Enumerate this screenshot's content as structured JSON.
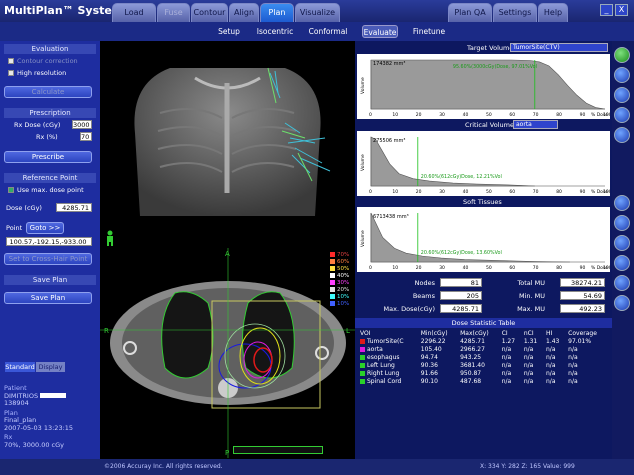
{
  "app": {
    "title": "MultiPlan™ System"
  },
  "tabs": [
    {
      "label": "Load",
      "state": "normal"
    },
    {
      "label": "Fuse",
      "state": "disabled"
    },
    {
      "label": "Contour",
      "state": "normal"
    },
    {
      "label": "Align",
      "state": "normal"
    },
    {
      "label": "Plan",
      "state": "active"
    },
    {
      "label": "Visualize",
      "state": "normal"
    },
    {
      "label": "Plan QA",
      "state": "normal"
    },
    {
      "label": "Settings",
      "state": "normal"
    },
    {
      "label": "Help",
      "state": "normal"
    }
  ],
  "window": {
    "minimize": "_",
    "close": "X"
  },
  "subtabs": [
    {
      "label": "Setup"
    },
    {
      "label": "Isocentric"
    },
    {
      "label": "Conformal"
    },
    {
      "label": "Evaluate",
      "active": true
    },
    {
      "label": "Finetune"
    }
  ],
  "left": {
    "evaluation": {
      "header": "Evaluation",
      "contour_correction": "Contour correction",
      "high_resolution": "High resolution",
      "calculate": "Calculate"
    },
    "prescription": {
      "header": "Prescription",
      "rx_dose_label": "Rx Dose (cGy)",
      "rx_dose_value": "3000",
      "rx_pct_label": "Rx (%)",
      "rx_pct_value": "70",
      "prescribe": "Prescribe"
    },
    "reference": {
      "header": "Reference Point",
      "use_max": "Use max. dose point",
      "dose_label": "Dose (cGy)",
      "dose_value": "4285.71",
      "point_label": "Point",
      "goto": "Goto >>",
      "point_value": "100.57,-192.15,-933.00",
      "set_crosshair": "Set to Cross-Hair Point"
    },
    "save": {
      "header": "Save Plan",
      "save_button": "Save Plan"
    },
    "view_tabs": [
      "Standard",
      "Display"
    ],
    "patient": {
      "label": "Patient",
      "name": "DIMITRIOS",
      "id": "138904",
      "plan_label": "Plan",
      "plan_name": "Final_plan",
      "plan_date": "2007-05-03 13:23:15",
      "rx_label": "Rx",
      "rx_value": "70%, 3000.00 cGy"
    }
  },
  "center": {
    "axial_label_top": "A",
    "axial_label_bottom": "P",
    "axial_label_right": "L",
    "axial_label_left": "R",
    "iso_legend": [
      "70%",
      "60%",
      "50%",
      "40%",
      "30%",
      "20%",
      "10%",
      "10%"
    ]
  },
  "right": {
    "target_volume_label": "Target Volume:",
    "target_volume": "TumorSite(CTV)",
    "target_plot": {
      "vol": "174382 mm³",
      "annotation": "95.60%(3000cGy)Dose, 97.01%Vol"
    },
    "critical_volume_label": "Critical Volume:",
    "critical_volume": "aorta",
    "critical_plot": {
      "vol": "275506 mm³",
      "annotation": "20.60%(612cGy)Dose, 12.21%Vol"
    },
    "soft_label": "Soft Tissues",
    "soft_plot": {
      "vol": "6713438 mm³",
      "annotation": "20.60%(612cGy)Dose, 13.60%Vol"
    },
    "axis": {
      "ylabel": "Volume",
      "xlabel": "% Dose",
      "xticks": [
        "0",
        "10",
        "20",
        "30",
        "40",
        "50",
        "60",
        "70",
        "80",
        "90",
        "100"
      ]
    },
    "stats": {
      "nodes_label": "Nodes",
      "nodes": "81",
      "beams_label": "Beams",
      "beams": "205",
      "maxdose_label": "Max. Dose(cGy)",
      "maxdose": "4285.71",
      "totalmu_label": "Total MU",
      "totalmu": "38274.21",
      "minmu_label": "Min. MU",
      "minmu": "54.69",
      "maxmu_label": "Max. MU",
      "maxmu": "492.23"
    },
    "table_title": "Dose Statistic Table",
    "table_headers": [
      "VOI",
      "Min(cGy)",
      "Max(cGy)",
      "CI",
      "nCI",
      "HI",
      "Coverage"
    ],
    "table_rows": [
      {
        "voi": "TumorSite(C",
        "min": "2296.22",
        "max": "4285.71",
        "ci": "1.27",
        "nci": "1.31",
        "hi": "1.43",
        "cov": "97.01%",
        "color": "#e01a1a"
      },
      {
        "voi": "aorta",
        "min": "105.40",
        "max": "2966.27",
        "ci": "n/a",
        "nci": "n/a",
        "hi": "n/a",
        "cov": "n/a",
        "color": "#e01ae0"
      },
      {
        "voi": "esophagus",
        "min": "94.74",
        "max": "943.25",
        "ci": "n/a",
        "nci": "n/a",
        "hi": "n/a",
        "cov": "n/a",
        "color": "#2ad02a"
      },
      {
        "voi": "Left Lung",
        "min": "90.36",
        "max": "3681.40",
        "ci": "n/a",
        "nci": "n/a",
        "hi": "n/a",
        "cov": "n/a",
        "color": "#2ad02a"
      },
      {
        "voi": "Right Lung",
        "min": "91.66",
        "max": "950.87",
        "ci": "n/a",
        "nci": "n/a",
        "hi": "n/a",
        "cov": "n/a",
        "color": "#2ad02a"
      },
      {
        "voi": "Spinal Cord",
        "min": "90.10",
        "max": "487.68",
        "ci": "n/a",
        "nci": "n/a",
        "hi": "n/a",
        "cov": "n/a",
        "color": "#2ad02a"
      }
    ]
  },
  "chart_data": [
    {
      "type": "line",
      "title": "TumorSite(CTV)",
      "xlabel": "% Dose",
      "ylabel": "Volume",
      "xlim": [
        0,
        100
      ],
      "ylim": [
        0,
        100
      ],
      "series": [
        {
          "values": [
            [
              0,
              100
            ],
            [
              60,
              100
            ],
            [
              68,
              99
            ],
            [
              72,
              96
            ],
            [
              76,
              88
            ],
            [
              80,
              70
            ],
            [
              84,
              48
            ],
            [
              88,
              28
            ],
            [
              92,
              12
            ],
            [
              96,
              3
            ],
            [
              100,
              0
            ]
          ]
        }
      ]
    },
    {
      "type": "line",
      "title": "aorta",
      "xlabel": "% Dose",
      "ylabel": "Volume",
      "xlim": [
        0,
        100
      ],
      "ylim": [
        0,
        100
      ],
      "series": [
        {
          "values": [
            [
              0,
              100
            ],
            [
              2,
              95
            ],
            [
              5,
              70
            ],
            [
              8,
              45
            ],
            [
              12,
              25
            ],
            [
              18,
              15
            ],
            [
              25,
              10
            ],
            [
              35,
              6
            ],
            [
              45,
              4
            ],
            [
              60,
              2
            ],
            [
              70,
              0
            ]
          ]
        }
      ]
    },
    {
      "type": "line",
      "title": "Soft Tissues",
      "xlabel": "% Dose",
      "ylabel": "Volume",
      "xlim": [
        0,
        100
      ],
      "ylim": [
        0,
        100
      ],
      "series": [
        {
          "values": [
            [
              0,
              100
            ],
            [
              2,
              80
            ],
            [
              5,
              50
            ],
            [
              10,
              28
            ],
            [
              15,
              18
            ],
            [
              22,
              12
            ],
            [
              30,
              8
            ],
            [
              40,
              5
            ],
            [
              55,
              3
            ],
            [
              70,
              1
            ],
            [
              85,
              0
            ]
          ]
        }
      ]
    }
  ],
  "bottom": {
    "copyright": "©2006 Accuray Inc. All rights reserved.",
    "coords": "X: 334  Y: 282  Z: 165  Value: 999"
  },
  "colors": {
    "accent": "#3a8df0",
    "panel": "#1e2da0",
    "plot_line": "#2ad02a"
  }
}
